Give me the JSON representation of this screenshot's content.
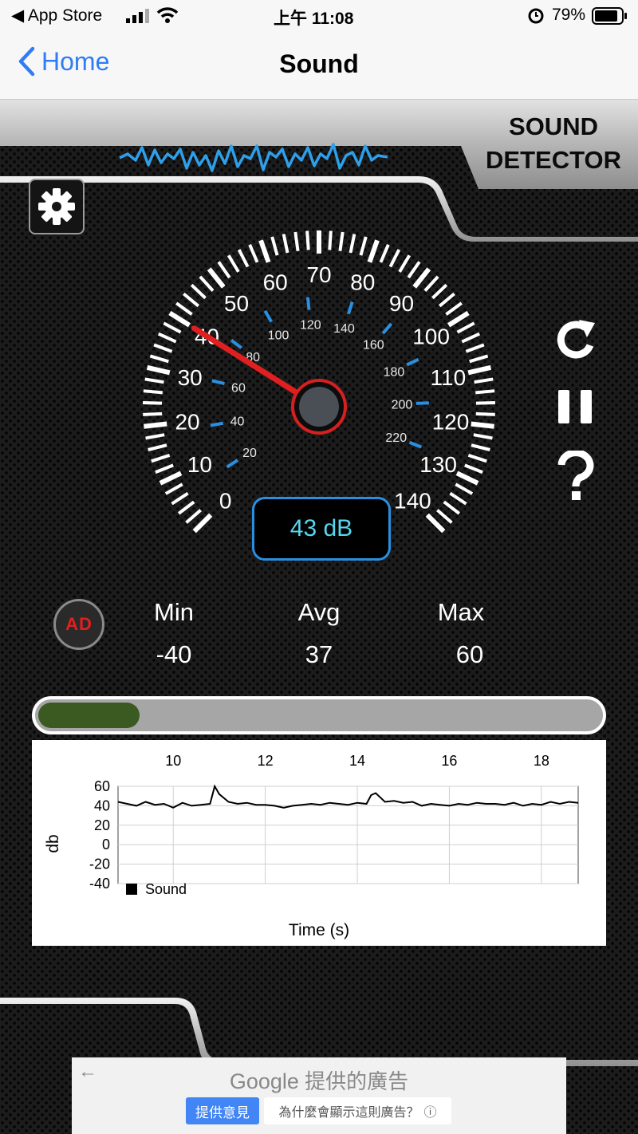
{
  "status_bar": {
    "back_app": "App Store",
    "time": "上午 11:08",
    "battery": "79%"
  },
  "nav": {
    "back_label": "Home",
    "title": "Sound"
  },
  "header": {
    "logo_line1": "SOUND",
    "logo_line2": "DETECTOR"
  },
  "gauge": {
    "outer_labels": [
      "0",
      "10",
      "20",
      "30",
      "40",
      "50",
      "60",
      "70",
      "80",
      "90",
      "100",
      "110",
      "120",
      "130",
      "140"
    ],
    "inner_labels": [
      "20",
      "40",
      "60",
      "80",
      "100",
      "120",
      "140",
      "160",
      "180",
      "200",
      "220"
    ],
    "needle_value": 40,
    "reading": "43 dB",
    "colors": {
      "needle": "#e02020",
      "inner_scale": "#2a8fe0",
      "reading_border": "#2a8fe0",
      "reading_text": "#55d6ee"
    }
  },
  "controls": {
    "settings": "gear-icon",
    "refresh": "refresh-icon",
    "pause": "pause-icon",
    "help": "question-icon",
    "ad_badge": "AD"
  },
  "stats": {
    "min_label": "Min",
    "avg_label": "Avg",
    "max_label": "Max",
    "min_value": "-40",
    "avg_value": "37",
    "max_value": "60"
  },
  "level_bar": {
    "fill_fraction": 0.18,
    "fill_color": "#3a5a22"
  },
  "chart_data": {
    "type": "line",
    "xlabel": "Time (s)",
    "ylabel": "db",
    "xlim": [
      8.8,
      18.8
    ],
    "ylim": [
      -40,
      60
    ],
    "x_ticks": [
      "10",
      "12",
      "14",
      "16",
      "18"
    ],
    "y_ticks": [
      "60",
      "40",
      "20",
      "0",
      "-20",
      "-40"
    ],
    "legend": "bottom-left",
    "grid": true,
    "series": [
      {
        "name": "Sound",
        "x": [
          8.8,
          9.0,
          9.2,
          9.4,
          9.6,
          9.8,
          10.0,
          10.2,
          10.4,
          10.6,
          10.8,
          10.9,
          11.0,
          11.2,
          11.4,
          11.6,
          11.8,
          12.0,
          12.2,
          12.4,
          12.6,
          12.8,
          13.0,
          13.2,
          13.4,
          13.6,
          13.8,
          14.0,
          14.2,
          14.3,
          14.4,
          14.6,
          14.8,
          15.0,
          15.2,
          15.4,
          15.6,
          15.8,
          16.0,
          16.2,
          16.4,
          16.6,
          16.8,
          17.0,
          17.2,
          17.4,
          17.6,
          17.8,
          18.0,
          18.2,
          18.4,
          18.6,
          18.8
        ],
        "y": [
          44,
          42,
          40,
          44,
          41,
          42,
          38,
          43,
          40,
          41,
          42,
          60,
          52,
          44,
          42,
          43,
          41,
          41,
          40,
          38,
          40,
          41,
          42,
          41,
          43,
          42,
          41,
          43,
          42,
          51,
          53,
          44,
          45,
          43,
          44,
          40,
          42,
          41,
          40,
          42,
          41,
          43,
          42,
          42,
          41,
          43,
          40,
          42,
          41,
          44,
          42,
          44,
          43
        ]
      }
    ]
  },
  "ad": {
    "back_arrow": "←",
    "provider": "Google",
    "title_suffix": "提供的廣告",
    "feedback_button": "提供意見",
    "why_button": "為什麼會顯示這則廣告？",
    "info_icon": "ⓘ"
  }
}
